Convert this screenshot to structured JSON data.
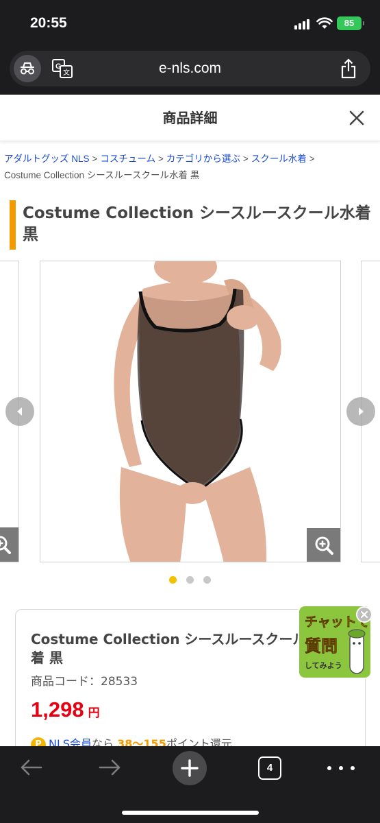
{
  "status_bar": {
    "time": "20:55",
    "battery": "85"
  },
  "browser": {
    "url": "e-nls.com",
    "tracker_icon": "incognito-icon",
    "translate_icon": "translate-icon",
    "share_icon": "share-icon",
    "tabs_count": "4"
  },
  "header": {
    "title": "商品詳細",
    "close_icon": "close-icon"
  },
  "breadcrumb": {
    "items": [
      "アダルトグッズ NLS",
      "コスチューム",
      "カテゴリから選ぶ",
      "スクール水着"
    ],
    "current": "Costume Collection シースルースクール水着  黒",
    "separator": ">"
  },
  "product": {
    "title": "Costume Collection シースルースクール水着 黒",
    "card_title": "Costume Collection シースルースクール水着 黒",
    "code_label": "商品コード：",
    "code": "28533",
    "price": "1,298",
    "price_unit": "円",
    "points_member": "NLS会員",
    "points_mid": "なら",
    "points_range": "38〜155",
    "points_suffix": "ポイント還元"
  },
  "carousel": {
    "active_index": 0,
    "slides": 3
  },
  "chat": {
    "line1": "チャットで",
    "line2": "質問",
    "line3": "してみよう"
  },
  "colors": {
    "accent_orange": "#f29a00",
    "price_red": "#e60012",
    "link_blue": "#1a4bd6",
    "chat_green": "#8cc63f",
    "dot_active": "#f5c000"
  }
}
